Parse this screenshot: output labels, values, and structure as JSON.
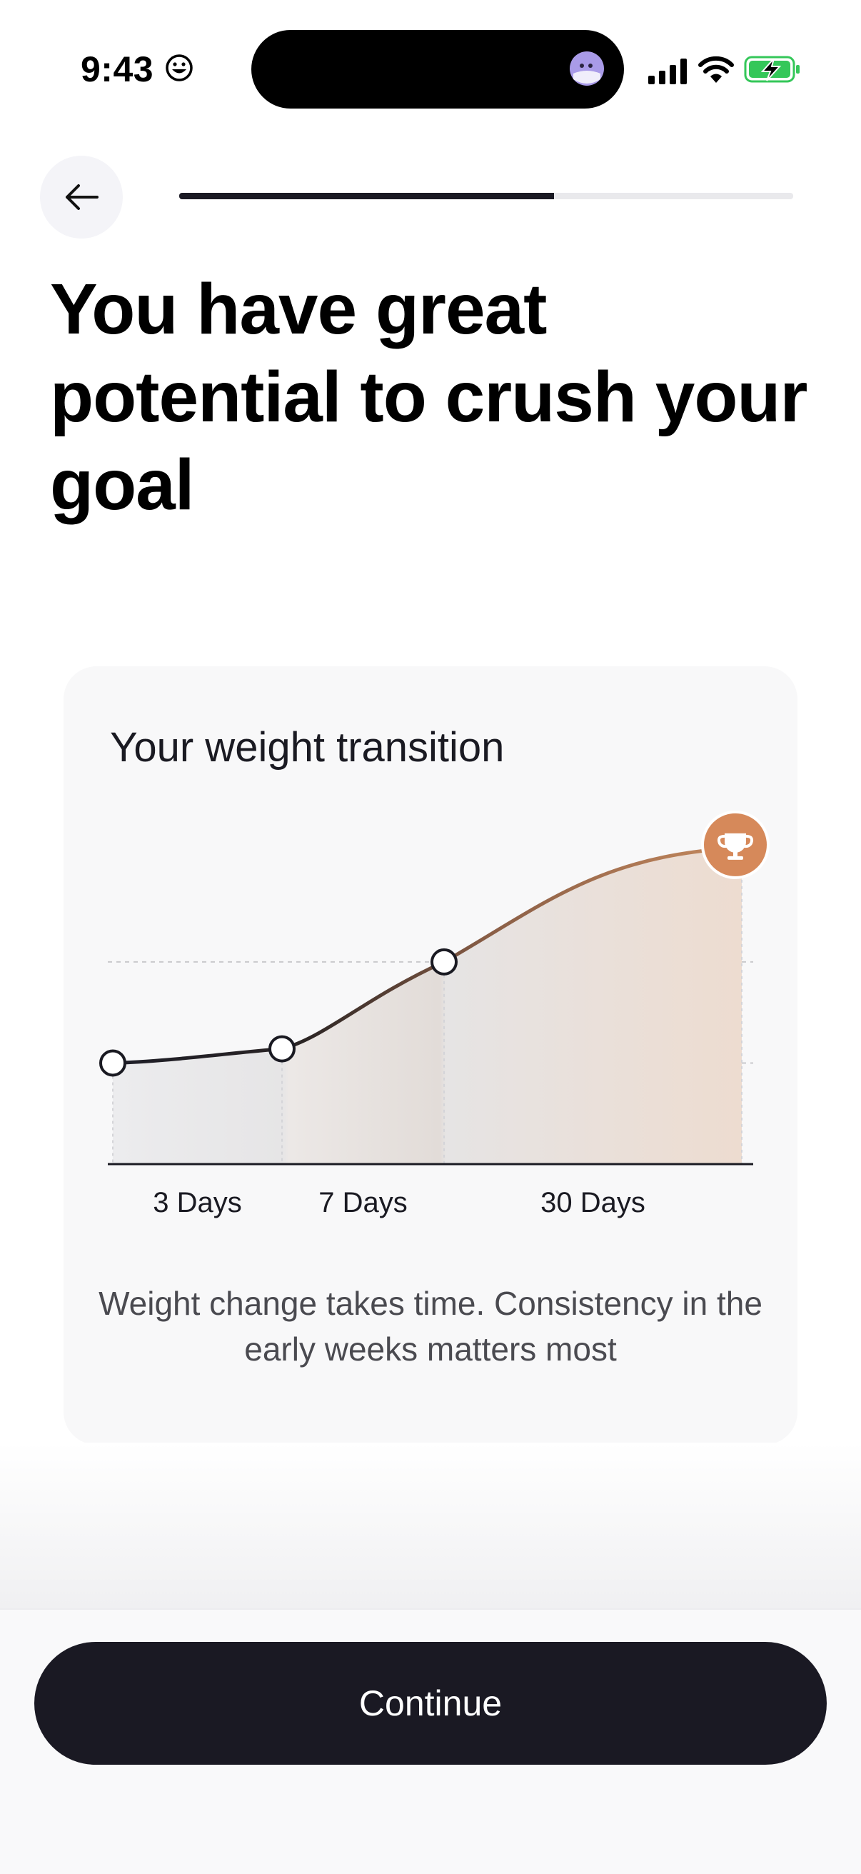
{
  "status_bar": {
    "time": "9:43",
    "icons": [
      "smiley-emoji-icon",
      "island-avatar-icon",
      "cellular-signal-icon",
      "wifi-icon",
      "battery-charging-icon"
    ]
  },
  "header": {
    "back_icon": "arrow-left-icon",
    "progress": 0.61
  },
  "title": "You have great potential to crush your goal",
  "card": {
    "title": "Your weight transition",
    "note": "Weight change takes time. Consistency in the early weeks matters most",
    "trophy_icon": "trophy-icon"
  },
  "chart_data": {
    "type": "area",
    "title": "Your weight transition",
    "categories": [
      "3 Days",
      "7 Days",
      "30 Days"
    ],
    "series": [
      {
        "values": [
          0.0,
          0.14,
          1.0,
          2.13
        ]
      }
    ],
    "gridlines": "dashed",
    "colors": {
      "line_start": "#1e1e28",
      "line_end": "#c68a5e",
      "marker": "#d6895a"
    }
  },
  "footer": {
    "continue_label": "Continue"
  },
  "colors": {
    "primary": "#1a1923",
    "accent": "#d6895a",
    "card_bg": "#f8f8f9"
  }
}
